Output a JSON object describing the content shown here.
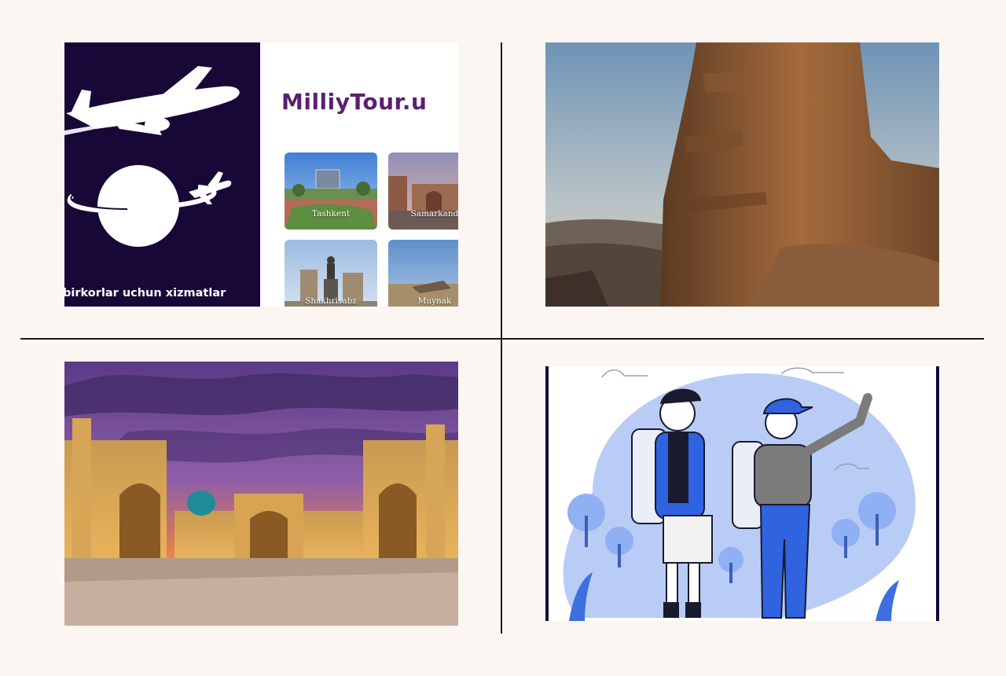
{
  "panels": {
    "milliytour": {
      "brand": "MilliyTour.u",
      "tagline": "birkorlar uchun xizmatlar",
      "cities": [
        {
          "name": "Tashkent"
        },
        {
          "name": "Samarkand"
        },
        {
          "name": "Shakhrisabz"
        },
        {
          "name": "Muynak"
        }
      ]
    }
  },
  "colors": {
    "background": "#fbf6f1",
    "navy": "#170838",
    "brand_purple": "#5a1f73",
    "illustration_blue": "#2f63e0",
    "illustration_light_blue": "#b9ccf6"
  }
}
